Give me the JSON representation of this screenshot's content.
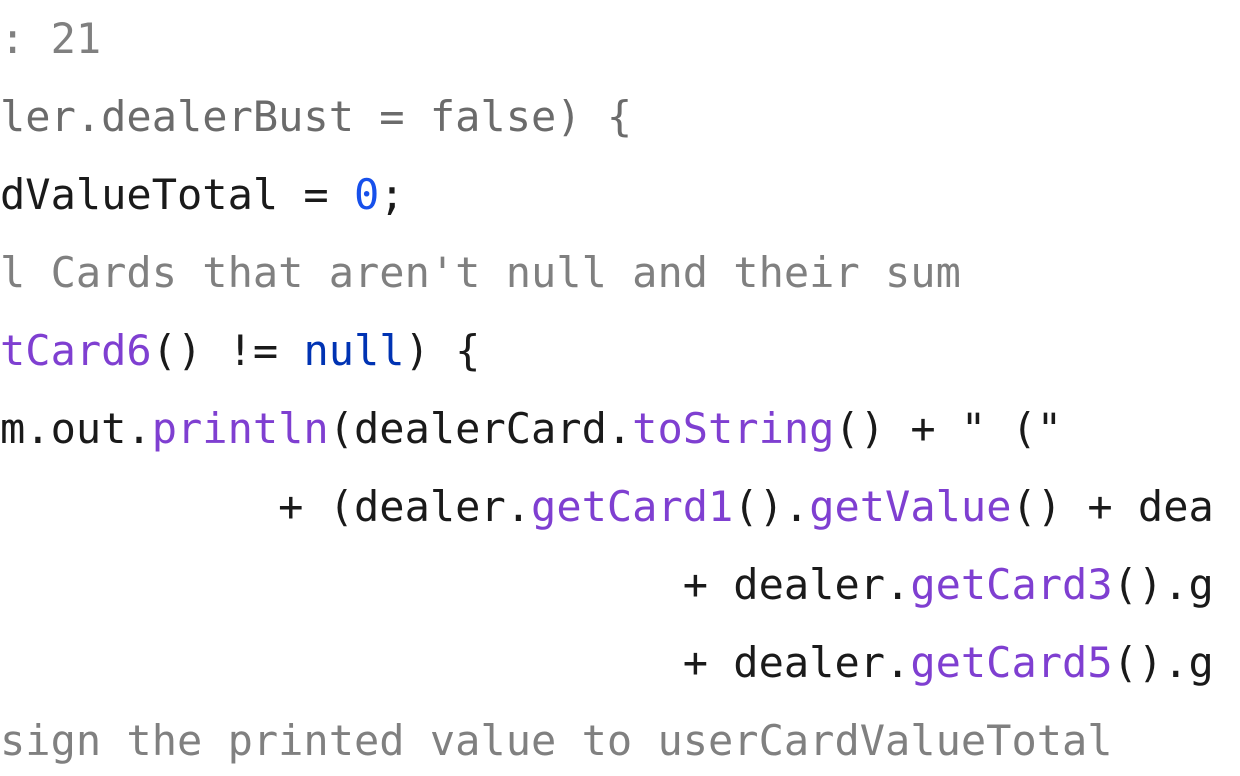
{
  "editor": {
    "colors": {
      "default": "#1a1a1a",
      "comment": "#808080",
      "muted": "#6b6b6b",
      "number": "#1750eb",
      "keyword": "#0033b3",
      "method": "#7f3fd1",
      "string": "#067d17"
    },
    "lines": [
      {
        "indent": "",
        "tokens": [
          {
            "t": "comment",
            "v": ": 21"
          }
        ]
      },
      {
        "indent": "",
        "tokens": [
          {
            "t": "muted",
            "v": "ler.dealerBust = false) {"
          }
        ]
      },
      {
        "indent": "",
        "tokens": [
          {
            "t": "default",
            "v": "dValueTotal = "
          },
          {
            "t": "number",
            "v": "0"
          },
          {
            "t": "default",
            "v": ";"
          }
        ]
      },
      {
        "indent": "",
        "tokens": [
          {
            "t": "comment",
            "v": "l Cards that aren't null and their sum"
          }
        ]
      },
      {
        "indent": "",
        "tokens": [
          {
            "t": "method",
            "v": "tCard6"
          },
          {
            "t": "default",
            "v": "() != "
          },
          {
            "t": "keyword",
            "v": "null"
          },
          {
            "t": "default",
            "v": ") {"
          }
        ]
      },
      {
        "indent": "",
        "tokens": [
          {
            "t": "default",
            "v": "m.out."
          },
          {
            "t": "method",
            "v": "println"
          },
          {
            "t": "default",
            "v": "(dealerCard."
          },
          {
            "t": "method",
            "v": "toString"
          },
          {
            "t": "default",
            "v": "() + \" (\""
          }
        ]
      },
      {
        "indent": "           ",
        "tokens": [
          {
            "t": "default",
            "v": "+ (dealer."
          },
          {
            "t": "method",
            "v": "getCard1"
          },
          {
            "t": "default",
            "v": "()."
          },
          {
            "t": "method",
            "v": "getValue"
          },
          {
            "t": "default",
            "v": "() + dea"
          }
        ]
      },
      {
        "indent": "                           ",
        "tokens": [
          {
            "t": "default",
            "v": "+ dealer."
          },
          {
            "t": "method",
            "v": "getCard3"
          },
          {
            "t": "default",
            "v": "().g"
          }
        ]
      },
      {
        "indent": "                           ",
        "tokens": [
          {
            "t": "default",
            "v": "+ dealer."
          },
          {
            "t": "method",
            "v": "getCard5"
          },
          {
            "t": "default",
            "v": "().g"
          }
        ]
      },
      {
        "indent": "",
        "tokens": [
          {
            "t": "comment",
            "v": "sign the printed value to userCardValueTotal"
          }
        ]
      }
    ]
  }
}
